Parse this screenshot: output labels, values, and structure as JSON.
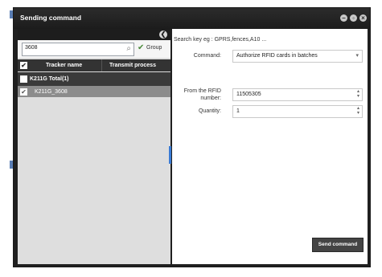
{
  "dialog": {
    "title": "Sending command",
    "buttons": [
      "minimize",
      "restore",
      "close"
    ]
  },
  "left_panel": {
    "search": {
      "value": "3608"
    },
    "group": {
      "checked": true,
      "label": "Group"
    },
    "table": {
      "headers": [
        "Tracker name",
        "Transmit process"
      ],
      "groups": [
        {
          "name": "K211G Total(1)",
          "trackers": [
            {
              "name": "K211G_3608",
              "checked": true
            }
          ]
        }
      ]
    }
  },
  "right_panel": {
    "hint": "Search key eg : GPRS,fences,A10 ...",
    "command": {
      "label": "Command:",
      "value": "Authorize RFID cards in batches"
    },
    "from_rfid": {
      "label_line1": "From the RFID",
      "label_line2": "number:",
      "value": "11505305"
    },
    "quantity": {
      "label": "Quantity:",
      "value": "1"
    },
    "send_button": "Send command"
  },
  "icons": {
    "check": "✔",
    "collapse": "❮",
    "search": "⌕",
    "dropdown": "▾",
    "spinner_up": "▴",
    "spinner_down": "▾"
  },
  "colors": {
    "titlebar": "#202020",
    "selected_row": "#8c8c8c",
    "accent": "#3a7bd5"
  }
}
